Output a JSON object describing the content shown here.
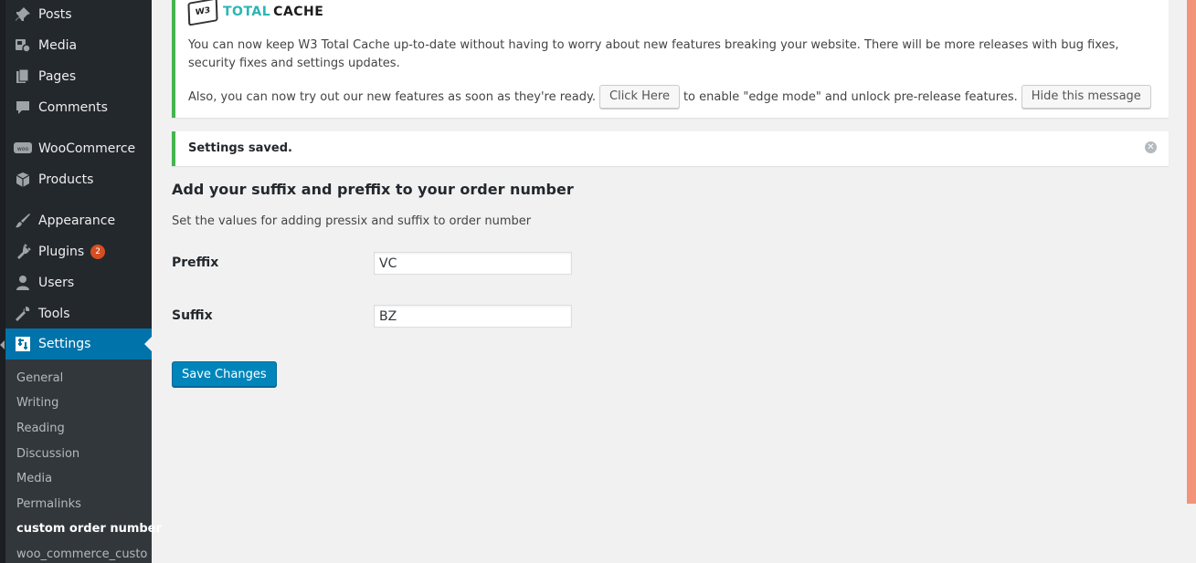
{
  "sidebar": {
    "menu": [
      {
        "label": "Posts",
        "icon": "pin-icon"
      },
      {
        "label": "Media",
        "icon": "media-icon"
      },
      {
        "label": "Pages",
        "icon": "pages-icon"
      },
      {
        "label": "Comments",
        "icon": "comment-icon"
      },
      {
        "label": "WooCommerce",
        "icon": "woo-icon"
      },
      {
        "label": "Products",
        "icon": "products-icon"
      },
      {
        "label": "Appearance",
        "icon": "brush-icon"
      },
      {
        "label": "Plugins",
        "icon": "plug-icon",
        "badge": "2"
      },
      {
        "label": "Users",
        "icon": "users-icon"
      },
      {
        "label": "Tools",
        "icon": "wrench-icon"
      },
      {
        "label": "Settings",
        "icon": "settings-icon",
        "current": true
      }
    ],
    "submenu": [
      {
        "label": "General"
      },
      {
        "label": "Writing"
      },
      {
        "label": "Reading"
      },
      {
        "label": "Discussion"
      },
      {
        "label": "Media"
      },
      {
        "label": "Permalinks"
      },
      {
        "label": "custom order number",
        "active": true
      },
      {
        "label": "woo_commerce_custo"
      }
    ]
  },
  "w3_notice": {
    "logo_total": "TOTAL",
    "logo_cache": "CACHE",
    "logo_box": "W3",
    "text": "You can now keep W3 Total Cache up-to-date without having to worry about new features breaking your website. There will be more releases with bug fixes, security fixes and settings updates.",
    "line2_before": "Also, you can now try out our new features as soon as they're ready.",
    "click_here": "Click Here",
    "line2_after": "to enable \"edge mode\" and unlock pre-release features.",
    "hide_button": "Hide this message"
  },
  "saved_notice": {
    "text": "Settings saved."
  },
  "form": {
    "heading": "Add your suffix and preffix to your order number",
    "description": "Set the values for adding pressix and suffix to order number",
    "prefix_label": "Preffix",
    "prefix_value": "VC",
    "suffix_label": "Suffix",
    "suffix_value": "BZ",
    "save_button": "Save Changes"
  },
  "colors": {
    "sidebar_bg": "#23282d",
    "submenu_bg": "#32373c",
    "accent": "#0073aa",
    "success": "#46b450",
    "badge": "#d54e21"
  }
}
